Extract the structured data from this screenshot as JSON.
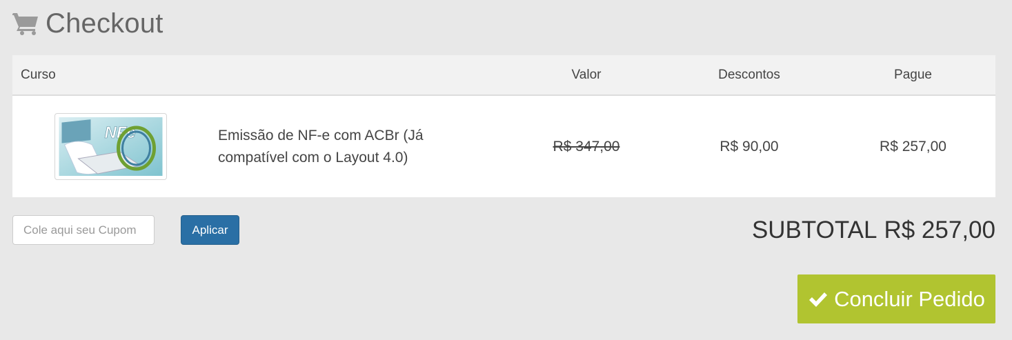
{
  "header": {
    "title": "Checkout",
    "icon": "shopping-cart-icon"
  },
  "table": {
    "columns": {
      "course": "Curso",
      "price": "Valor",
      "discounts": "Descontos",
      "pay": "Pague"
    },
    "rows": [
      {
        "thumbnail_label": "NFe",
        "course": "Emissão de NF-e com ACBr (Já compatível com o Layout 4.0)",
        "price": "R$ 347,00",
        "discount": "R$ 90,00",
        "pay": "R$ 257,00"
      }
    ]
  },
  "coupon": {
    "placeholder": "Cole aqui seu Cupom",
    "apply_label": "Aplicar"
  },
  "subtotal": {
    "label": "SUBTOTAL",
    "value": "R$ 257,00"
  },
  "conclude": {
    "label": "Concluir Pedido",
    "icon": "check-icon"
  },
  "colors": {
    "apply": "#2a6fa5",
    "conclude": "#b1c430",
    "background": "#e8e8e8"
  }
}
